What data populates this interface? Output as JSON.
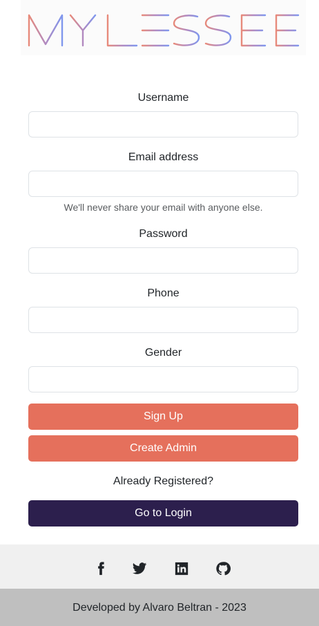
{
  "logo": {
    "text": "MYLESSEE"
  },
  "form": {
    "username_label": "Username",
    "username_value": "",
    "email_label": "Email address",
    "email_value": "",
    "email_help": "We'll never share your email with anyone else.",
    "password_label": "Password",
    "password_value": "",
    "phone_label": "Phone",
    "phone_value": "",
    "gender_label": "Gender",
    "gender_value": ""
  },
  "actions": {
    "signup_label": "Sign Up",
    "create_admin_label": "Create Admin",
    "already_registered": "Already Registered?",
    "go_login_label": "Go to Login"
  },
  "social": {
    "icons": [
      "facebook-icon",
      "twitter-icon",
      "linkedin-icon",
      "github-icon"
    ]
  },
  "footer": {
    "text": "Developed by Alvaro Beltran - 2023"
  },
  "colors": {
    "primary_button": "#e5705c",
    "login_button": "#2c1f4d",
    "social_bar": "#f0f0f0",
    "footer_bar": "#bfbfbf"
  }
}
